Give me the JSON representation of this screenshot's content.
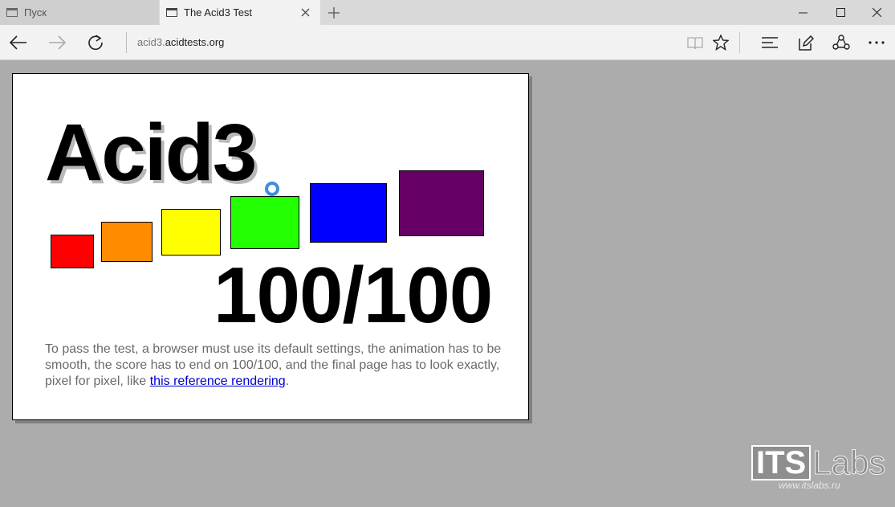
{
  "tabs": [
    {
      "title": "Пуск",
      "active": false
    },
    {
      "title": "The Acid3 Test",
      "active": true
    }
  ],
  "address": {
    "prefix": "acid3.",
    "host": "acidtests.org"
  },
  "page": {
    "title": "Acid3",
    "score": "100/100",
    "instructions_before": "To pass the test, a browser must use its default settings, the animation has to be smooth, the score has to end on 100/100, and the final page has to look exactly, pixel for pixel, like ",
    "link_text": "this reference rendering",
    "instructions_after": ".",
    "bucket_colors": [
      "#ff0000",
      "#ff8c00",
      "#ffff00",
      "#22ff00",
      "#0000ff",
      "#660066"
    ],
    "loader_color": "#3f8ee0"
  },
  "watermark": {
    "brand_its": "ITS",
    "brand_labs": "Labs",
    "url": "www.itslabs.ru"
  },
  "icons": {
    "tab_favicon": "page-icon",
    "tab_close": "close-icon",
    "new_tab": "plus-icon",
    "back": "back-arrow-icon",
    "forward": "forward-arrow-icon",
    "refresh": "refresh-icon",
    "reading_view": "book-icon",
    "favorite": "star-icon",
    "hub": "hub-lines-icon",
    "web_note": "pen-note-icon",
    "share": "share-icon",
    "more": "more-dots-icon"
  }
}
